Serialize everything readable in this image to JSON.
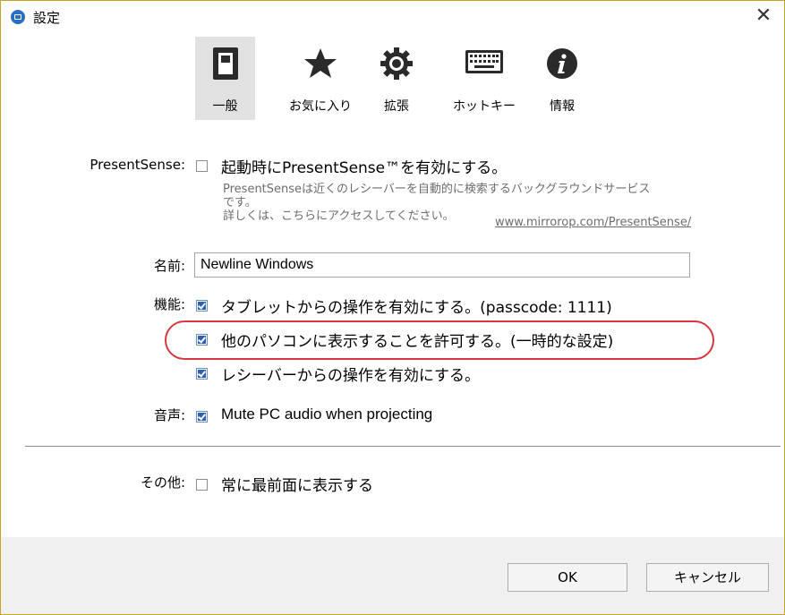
{
  "window": {
    "title": "設定",
    "app_icon": "mirrorop-app-icon",
    "close_label": "✕"
  },
  "tabs": [
    {
      "label": "一般",
      "icon": "general-panel-icon",
      "active": true
    },
    {
      "label": "お気に入り",
      "icon": "star-icon",
      "active": false
    },
    {
      "label": "拡張",
      "icon": "gear-icon",
      "active": false
    },
    {
      "label": "ホットキー",
      "icon": "keyboard-icon",
      "active": false
    },
    {
      "label": "情報",
      "icon": "info-icon",
      "active": false
    }
  ],
  "present_sense": {
    "label": "PresentSense:",
    "checkbox_text": "起動時にPresentSense™を有効にする。",
    "checked": false,
    "note_line1": "PresentSenseは近くのレシーバーを自動的に検索するバックグラウンドサービス",
    "note_line2": "です。",
    "note_line3": "詳しくは、こちらにアクセスしてください。",
    "link": "www.mirrorop.com/PresentSense/"
  },
  "name": {
    "label": "名前:",
    "value": "Newline Windows"
  },
  "features": {
    "label": "機能:",
    "items": [
      {
        "text": "タブレットからの操作を有効にする。(passcode: 1111)",
        "checked": true
      },
      {
        "text": "他のパソコンに表示することを許可する。(一時的な設定)",
        "checked": true
      },
      {
        "text": "レシーバーからの操作を有効にする。",
        "checked": true
      }
    ]
  },
  "audio": {
    "label": "音声:",
    "text": "Mute PC audio when projecting",
    "checked": true
  },
  "other": {
    "label": "その他:",
    "text": "常に最前面に表示する",
    "checked": false
  },
  "buttons": {
    "ok": "OK",
    "cancel": "キャンセル"
  },
  "colors": {
    "highlight": "#d7373f",
    "checkbox": "#2c5fb3",
    "window_border": "#c9a227"
  }
}
